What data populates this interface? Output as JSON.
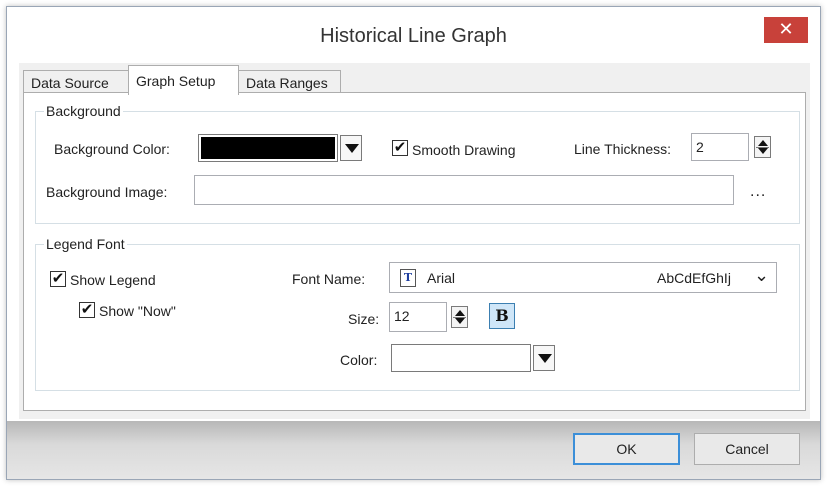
{
  "window": {
    "title": "Historical Line Graph",
    "close_glyph": "✕"
  },
  "tabs": [
    {
      "label": "Data Source",
      "active": false
    },
    {
      "label": "Graph Setup",
      "active": true
    },
    {
      "label": "Data Ranges",
      "active": false
    }
  ],
  "background_group": {
    "legend": "Background",
    "background_color_label": "Background Color:",
    "background_color_value": "#000000",
    "smooth_drawing_label": "Smooth Drawing",
    "smooth_drawing_checked": true,
    "line_thickness_label": "Line Thickness:",
    "line_thickness_value": "2",
    "background_image_label": "Background Image:",
    "background_image_value": "",
    "browse_label": "..."
  },
  "legend_font_group": {
    "legend": "Legend Font",
    "show_legend_label": "Show Legend",
    "show_legend_checked": true,
    "show_now_label": "Show \"Now\"",
    "show_now_checked": true,
    "font_name_label": "Font Name:",
    "font_name_value": "Arial",
    "font_preview": "AbCdEfGhIj",
    "size_label": "Size:",
    "size_value": "12",
    "bold_label": "B",
    "color_label": "Color:",
    "color_value": "#ffffff"
  },
  "footer": {
    "ok_label": "OK",
    "cancel_label": "Cancel"
  },
  "glyphs": {
    "check": "✔",
    "chevron": "⌄"
  }
}
